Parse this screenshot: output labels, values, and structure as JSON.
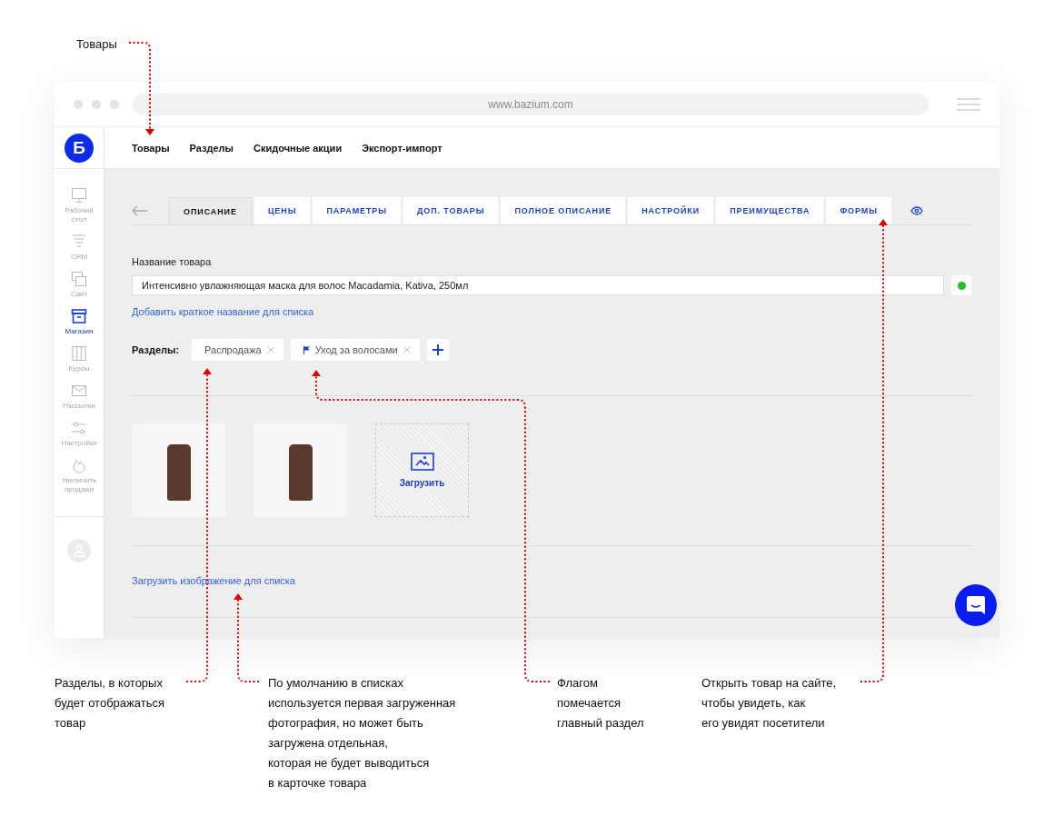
{
  "top_annotation": "Товары",
  "window": {
    "url": "www.bazium.com"
  },
  "app": {
    "logo": "Б",
    "nav": [
      {
        "label": "Товары"
      },
      {
        "label": "Разделы"
      },
      {
        "label": "Скидочные акции"
      },
      {
        "label": "Экспорт-импорт"
      }
    ]
  },
  "sidebar": {
    "items": [
      {
        "label": "Рабочий стол",
        "selected": false
      },
      {
        "label": "CRM",
        "selected": false
      },
      {
        "label": "Сайт",
        "selected": false
      },
      {
        "label": "Магазин",
        "selected": true
      },
      {
        "label": "Курсы",
        "selected": false
      },
      {
        "label": "Рассылки",
        "selected": false
      },
      {
        "label": "Настройки",
        "selected": false
      },
      {
        "label": "Увеличить продажи",
        "selected": false
      }
    ]
  },
  "tabs": [
    {
      "label": "ОПИСАНИЕ",
      "selected": true
    },
    {
      "label": "ЦЕНЫ",
      "selected": false
    },
    {
      "label": "ПАРАМЕТРЫ",
      "selected": false
    },
    {
      "label": "ДОП. ТОВАРЫ",
      "selected": false
    },
    {
      "label": "ПОЛНОЕ ОПИСАНИЕ",
      "selected": false
    },
    {
      "label": "НАСТРОЙКИ",
      "selected": false
    },
    {
      "label": "ПРЕИМУЩЕСТВА",
      "selected": false
    },
    {
      "label": "ФОРМЫ",
      "selected": false
    }
  ],
  "form": {
    "name_label": "Название товара",
    "name_value": "Интенсивно увлажняющая маска для волос Macadamia, Kativa, 250мл",
    "published": true,
    "short_name_link": "Добавить краткое название для списка",
    "sections_label": "Разделы:",
    "sections": [
      {
        "label": "Распродажа",
        "main": false
      },
      {
        "label": "Уход за волосами",
        "main": true
      }
    ],
    "images": [
      {
        "kind": "photo"
      },
      {
        "kind": "photo"
      }
    ],
    "upload_label": "Загрузить",
    "list_image_link": "Загрузить изображение для списка"
  },
  "annotations": [
    {
      "text": "Разделы, в которых\nбудет отображаться\nтовар"
    },
    {
      "text": "По умолчанию в списках\nиспользуется первая загруженная\nфотография, но может быть\nзагружена отдельная,\nкоторая не будет выводиться\nв карточке товара"
    },
    {
      "text": "Флагом\nпомечается\nглавный раздел"
    },
    {
      "text": "Открыть товар на сайте,\nчтобы увидеть, как\nего увидят посетители"
    }
  ]
}
